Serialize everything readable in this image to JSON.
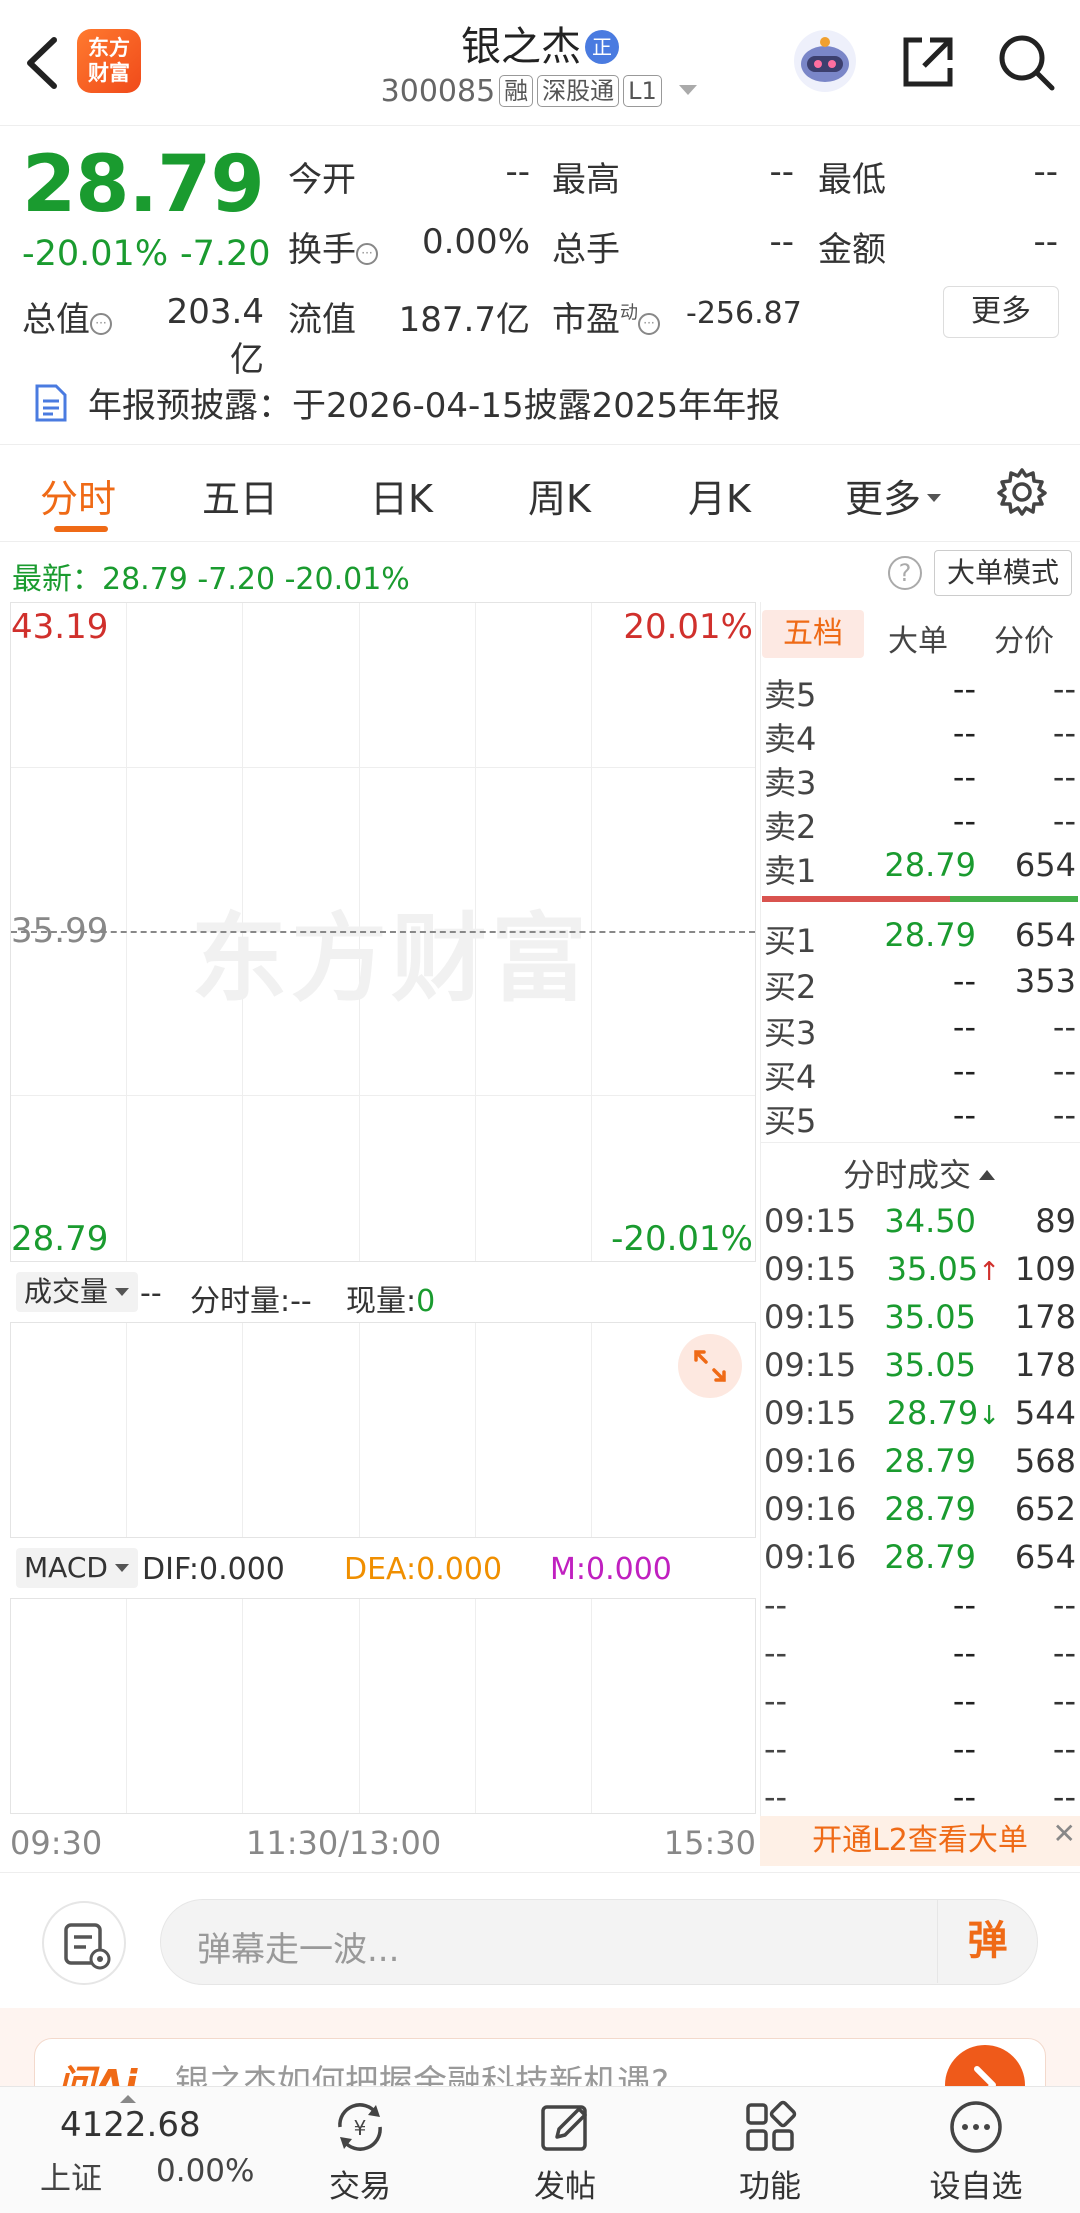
{
  "header": {
    "name": "银之杰",
    "badge": "正",
    "code": "300085",
    "tag_margin": "融",
    "tag_connect": "深股通",
    "tag_level": "L1",
    "logo_line1": "东方",
    "logo_line2": "财富"
  },
  "quote": {
    "price": "28.79",
    "pct": "-20.01%",
    "change": "-7.20",
    "open_label": "今开",
    "open_value": "--",
    "high_label": "最高",
    "high_value": "--",
    "low_label": "最低",
    "low_value": "--",
    "turnover_label": "换手",
    "turnover_value": "0.00%",
    "volume_label": "总手",
    "volume_value": "--",
    "amount_label": "金额",
    "amount_value": "--",
    "mktcap_label": "总值",
    "mktcap_value": "203.4亿",
    "float_label": "流值",
    "float_value": "187.7亿",
    "pe_label": "市盈",
    "pe_sup": "动",
    "pe_value": "-256.87",
    "more_label": "更多"
  },
  "notice": {
    "text": "年报预披露：于2026-04-15披露2025年年报"
  },
  "tabs": [
    "分时",
    "五日",
    "日K",
    "周K",
    "月K",
    "更多"
  ],
  "latest": {
    "text": "最新：28.79  -7.20  -20.01%",
    "mode_label": "大单模式",
    "help": "?"
  },
  "chart": {
    "top_price": "43.19",
    "top_pct": "20.01%",
    "mid_price": "35.99",
    "bottom_price": "28.79",
    "bottom_pct": "-20.01%",
    "watermark": "东方财富",
    "time_start": "09:30",
    "time_mid": "11:30/13:00",
    "time_end": "15:30"
  },
  "volume": {
    "select_label": "成交量",
    "dash": "--",
    "period_label": "分时量:--",
    "now_label": "现量:",
    "now_value": "0"
  },
  "macd": {
    "select_label": "MACD",
    "dif": "DIF:0.000",
    "dea": "DEA:0.000",
    "m": "M:0.000"
  },
  "orderbook": {
    "tabs": [
      "五档",
      "大单",
      "分价"
    ],
    "sells": [
      {
        "label": "卖5",
        "price": "--",
        "vol": "--"
      },
      {
        "label": "卖4",
        "price": "--",
        "vol": "--"
      },
      {
        "label": "卖3",
        "price": "--",
        "vol": "--"
      },
      {
        "label": "卖2",
        "price": "--",
        "vol": "--"
      },
      {
        "label": "卖1",
        "price": "28.79",
        "vol": "654"
      }
    ],
    "buys": [
      {
        "label": "买1",
        "price": "28.79",
        "vol": "654"
      },
      {
        "label": "买2",
        "price": "--",
        "vol": "353"
      },
      {
        "label": "买3",
        "price": "--",
        "vol": "--"
      },
      {
        "label": "买4",
        "price": "--",
        "vol": "--"
      },
      {
        "label": "买5",
        "price": "--",
        "vol": "--"
      }
    ],
    "trades_title": "分时成交",
    "trades": [
      {
        "time": "09:15",
        "price": "34.50",
        "vol": "89",
        "arrow": ""
      },
      {
        "time": "09:15",
        "price": "35.05",
        "vol": "109",
        "arrow": "↑"
      },
      {
        "time": "09:15",
        "price": "35.05",
        "vol": "178",
        "arrow": ""
      },
      {
        "time": "09:15",
        "price": "35.05",
        "vol": "178",
        "arrow": ""
      },
      {
        "time": "09:15",
        "price": "28.79",
        "vol": "544",
        "arrow": "↓"
      },
      {
        "time": "09:16",
        "price": "28.79",
        "vol": "568",
        "arrow": ""
      },
      {
        "time": "09:16",
        "price": "28.79",
        "vol": "652",
        "arrow": ""
      },
      {
        "time": "09:16",
        "price": "28.79",
        "vol": "654",
        "arrow": ""
      },
      {
        "time": "--",
        "price": "--",
        "vol": "--",
        "arrow": ""
      },
      {
        "time": "--",
        "price": "--",
        "vol": "--",
        "arrow": ""
      },
      {
        "time": "--",
        "price": "--",
        "vol": "--",
        "arrow": ""
      },
      {
        "time": "--",
        "price": "--",
        "vol": "--",
        "arrow": ""
      },
      {
        "time": "--",
        "price": "--",
        "vol": "--",
        "arrow": ""
      }
    ],
    "l2_banner": "开通L2查看大单",
    "l2_close": "✕"
  },
  "comment": {
    "placeholder": "弹幕走一波...",
    "danmu_label": "弹"
  },
  "promo": {
    "logo": "问Ai",
    "text": "银之杰如何把握金融科技新机遇?"
  },
  "bottom_nav": {
    "index_value": "4122.68",
    "index_name": "上证",
    "index_change": "0.00%",
    "items": [
      "交易",
      "发帖",
      "功能",
      "设自选"
    ]
  },
  "colors": {
    "up": "#d0302c",
    "down": "#1a9b2f",
    "accent": "#ef6a16"
  }
}
